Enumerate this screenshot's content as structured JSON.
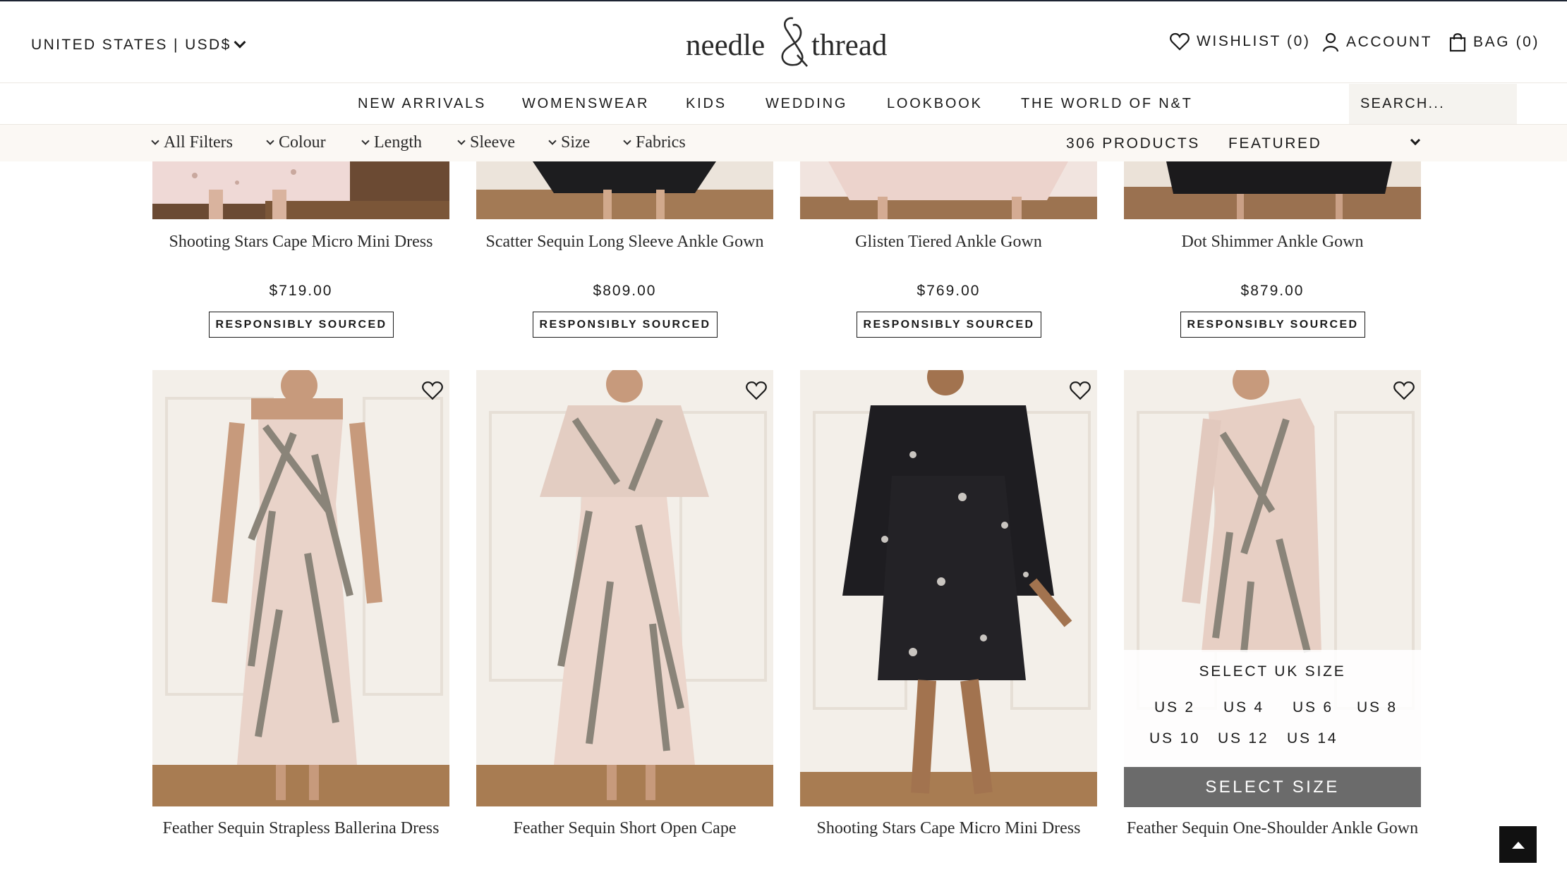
{
  "header": {
    "locale": "UNITED STATES | USD$",
    "logo_word1": "needle",
    "logo_word2": "thread",
    "wishlist": "WISHLIST (0)",
    "account": "ACCOUNT",
    "bag": "BAG (0)"
  },
  "nav": {
    "items": [
      "NEW ARRIVALS",
      "WOMENSWEAR",
      "KIDS",
      "WEDDING",
      "LOOKBOOK",
      "THE WORLD OF N&T"
    ],
    "search_placeholder": "SEARCH..."
  },
  "filters": {
    "items": [
      "All Filters",
      "Colour",
      "Length",
      "Sleeve",
      "Size",
      "Fabrics"
    ],
    "count": "306 PRODUCTS",
    "sort": "FEATURED"
  },
  "products_row1": [
    {
      "name": "Shooting Stars Cape Micro Mini Dress",
      "price": "$719.00",
      "badge": "RESPONSIBLY SOURCED"
    },
    {
      "name": "Scatter Sequin Long Sleeve Ankle Gown",
      "price": "$809.00",
      "badge": "RESPONSIBLY SOURCED"
    },
    {
      "name": "Glisten Tiered Ankle Gown",
      "price": "$769.00",
      "badge": "RESPONSIBLY SOURCED"
    },
    {
      "name": "Dot Shimmer Ankle Gown",
      "price": "$879.00",
      "badge": "RESPONSIBLY SOURCED"
    }
  ],
  "products_row2": [
    {
      "name": "Feather Sequin Strapless Ballerina Dress"
    },
    {
      "name": "Feather Sequin Short Open Cape"
    },
    {
      "name": "Shooting Stars Cape Micro Mini Dress"
    },
    {
      "name": "Feather Sequin One-Shoulder Ankle Gown"
    }
  ],
  "size_panel": {
    "title": "SELECT UK SIZE",
    "sizes": [
      "US 2",
      "US 4",
      "US 6",
      "US 8",
      "US 10",
      "US 12",
      "US 14"
    ],
    "button": "SELECT SIZE"
  },
  "icons": {
    "wishlist": "heart-icon",
    "account": "user-icon",
    "bag": "shopping-bag-icon",
    "back_to_top": "arrow-up-icon"
  }
}
